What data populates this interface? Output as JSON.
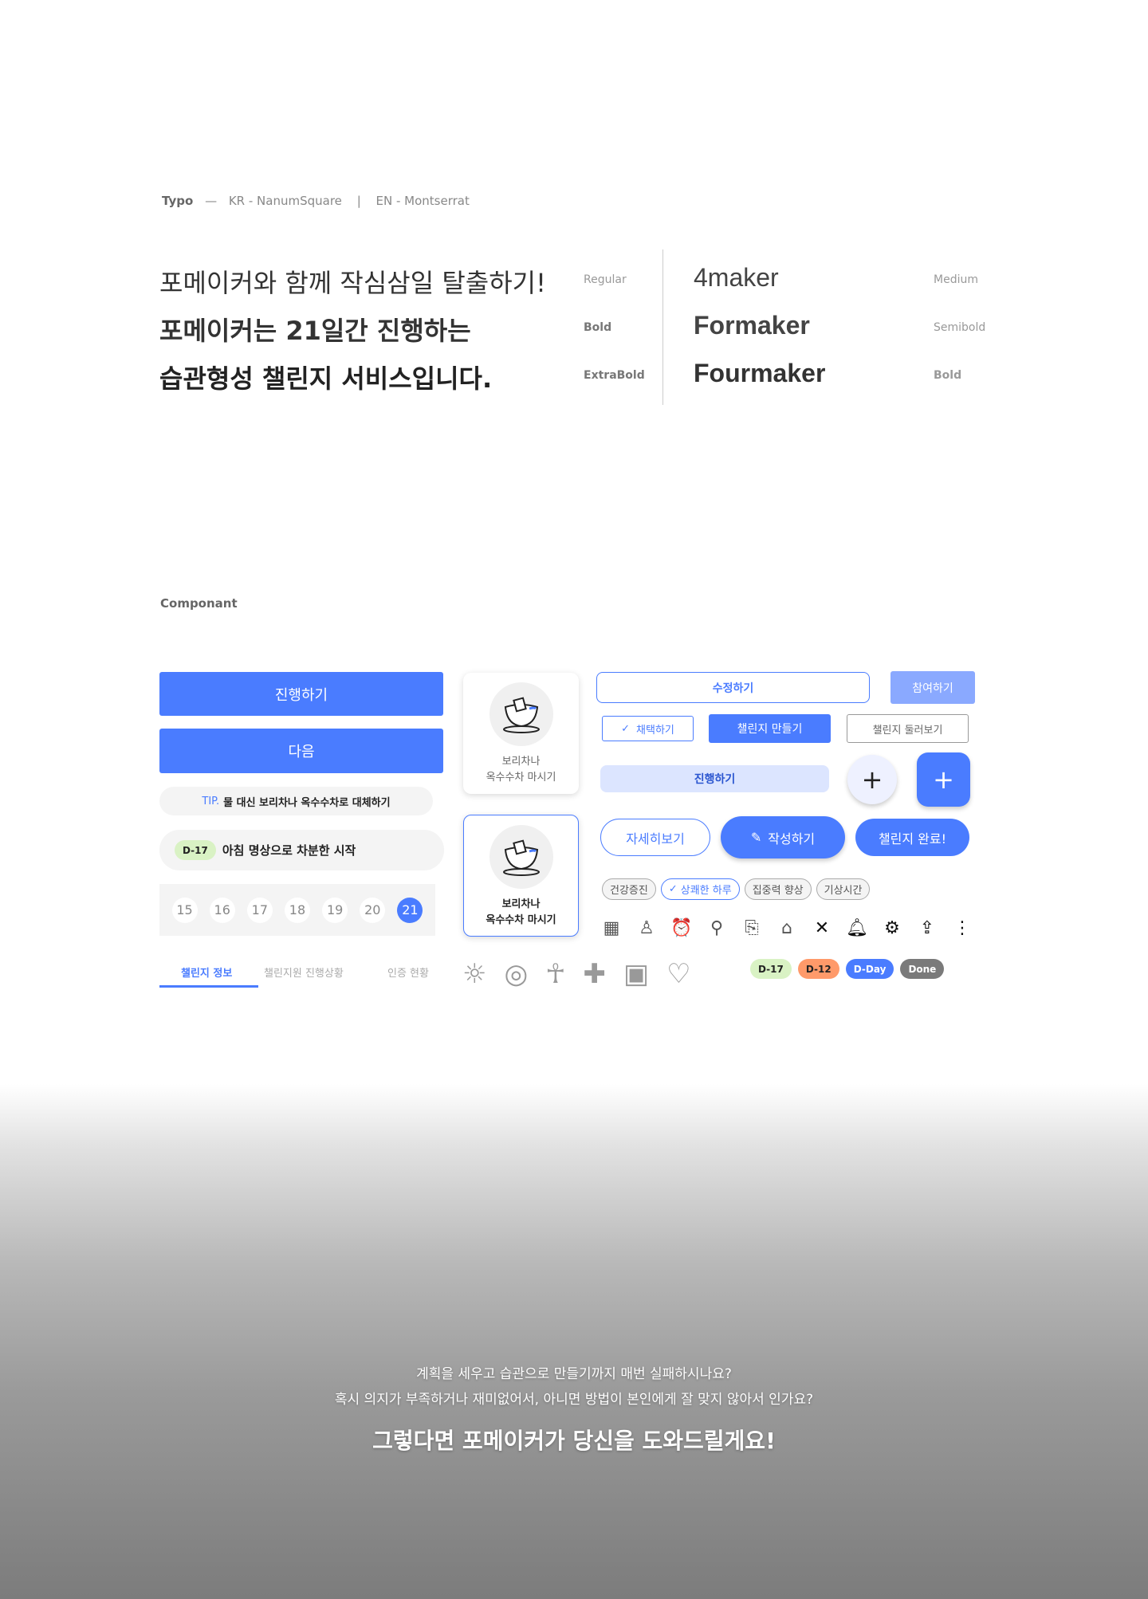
{
  "typo": {
    "title": "Typo",
    "dash": "—",
    "kr_font": "KR - NanumSquare",
    "sep": "|",
    "en_font": "EN - Montserrat",
    "kr_lines": [
      {
        "text": "포메이커와 함께 작심삼일 탈출하기!",
        "weight": "Regular"
      },
      {
        "text": "포메이커는 21일간 진행하는",
        "weight": "Bold"
      },
      {
        "text": "습관형성 챌린지 서비스입니다.",
        "weight": "ExtraBold"
      }
    ],
    "en_lines": [
      {
        "text": "4maker",
        "weight": "Medium"
      },
      {
        "text": "Formaker",
        "weight": "Semibold"
      },
      {
        "text": "Fourmaker",
        "weight": "Bold"
      }
    ]
  },
  "component": {
    "title": "Componant",
    "btn_proceed": "진행하기",
    "btn_next": "다음",
    "tip_label": "TIP.",
    "tip_text": "물 대신 보리차나 옥수수차로 대체하기",
    "dday_badge": "D-17",
    "dday_text": "아침 명상으로 차분한 시작",
    "dates": [
      "15",
      "16",
      "17",
      "18",
      "19",
      "20",
      "21"
    ],
    "selected_date": "21",
    "tabs": [
      "챌린지 정보",
      "챌린지원 진행상황",
      "인증 현황"
    ],
    "active_tab": "챌린지 정보",
    "card_line1": "보리차나",
    "card_line2": "옥수수차 마시기",
    "btn_edit": "수정하기",
    "btn_join": "참여하기",
    "btn_adopt": "채택하기",
    "btn_create": "챌린지 만들기",
    "btn_browse": "챌린지 둘러보기",
    "btn_proceed_light": "진행하기",
    "btn_detail": "자세히보기",
    "btn_write": "작성하기",
    "btn_complete": "챌린지 완료!",
    "chips": [
      "건강증진",
      "상쾌한 하루",
      "집중력 향상",
      "기상시간"
    ],
    "selected_chip": "상쾌한 하루",
    "icons": [
      "calendar-icon",
      "user-icon",
      "alarm-icon",
      "medal-icon",
      "clipboard-search-icon",
      "home-icon",
      "close-icon",
      "bell-icon",
      "gear-icon",
      "share-icon",
      "more-vertical-icon"
    ],
    "badges": [
      {
        "text": "D-17",
        "color": "#d9f2c4"
      },
      {
        "text": "D-12",
        "color": "#ff9a6a"
      },
      {
        "text": "D-Day",
        "color": "#4a7cff"
      },
      {
        "text": "Done",
        "color": "#7a7a7a"
      }
    ],
    "accent": "#4a7cff"
  },
  "hero": {
    "line1": "계획을 세우고 습관으로 만들기까지 매번 실패하시나요?",
    "line2": "혹시 의지가 부족하거나 재미없어서, 아니면 방법이 본인에게 잘 맞지 않아서 인가요?",
    "line3": "그렇다면  포메이커가 당신을 도와드릴게요!"
  }
}
